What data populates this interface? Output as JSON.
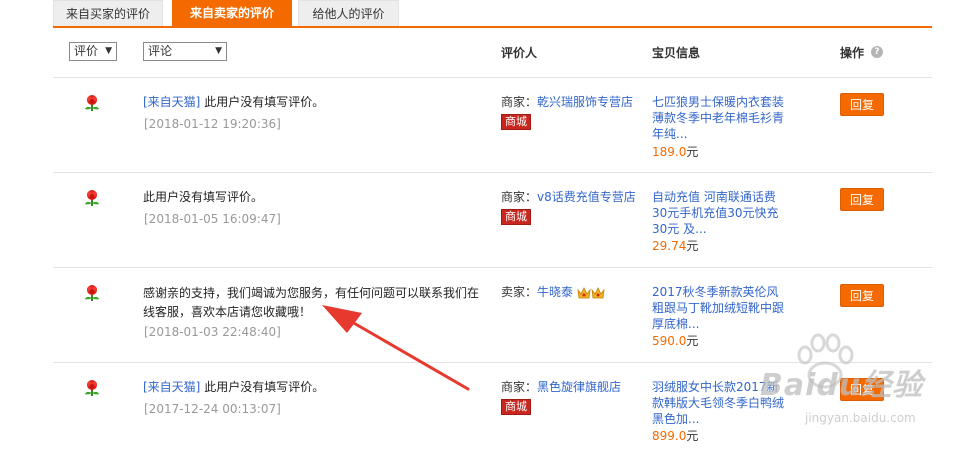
{
  "tabs": [
    {
      "label": "来自买家的评价"
    },
    {
      "label": "来自卖家的评价",
      "active": true
    },
    {
      "label": "给他人的评价"
    }
  ],
  "header": {
    "rating_filter": "评价",
    "comment_filter": "评论",
    "reviewer": "评价人",
    "item_info": "宝贝信息",
    "action": "操作",
    "help": "?"
  },
  "rows": [
    {
      "tag": "[来自天猫]",
      "comment": "此用户没有填写评价。",
      "time": "[2018-01-12 19:20:36]",
      "role": "商家：",
      "shop": "乾兴瑞服饰专营店",
      "badge": "商城",
      "item": "七匹狼男士保暖内衣套装薄款冬季中老年棉毛衫青年纯...",
      "price": "189.0",
      "unit": "元",
      "reply": "回复"
    },
    {
      "tag": "",
      "comment": "此用户没有填写评价。",
      "time": "[2018-01-05 16:09:47]",
      "role": "商家：",
      "shop": "v8话费充值专营店",
      "badge": "商城",
      "item": "自动充值 河南联通话费30元手机充值30元快充30元 及...",
      "price": "29.74",
      "unit": "元",
      "reply": "回复"
    },
    {
      "tag": "",
      "comment": "感谢亲的支持，我们竭诚为您服务，有任何问题可以联系我们在线客服，喜欢本店请您收藏哦！",
      "time": "[2018-01-03 22:48:40]",
      "role": "卖家：",
      "shop": "牛晓泰",
      "badge": "",
      "item": "2017秋冬季新款英伦风粗跟马丁靴加绒短靴中跟厚底棉...",
      "price": "590.0",
      "unit": "元",
      "reply": "回复"
    },
    {
      "tag": "[来自天猫]",
      "comment": "此用户没有填写评价。",
      "time": "[2017-12-24 00:13:07]",
      "role": "商家：",
      "shop": "黑色旋律旗舰店",
      "badge": "商城",
      "item": "羽绒服女中长款2017新款韩版大毛领冬季白鸭绒黑色加...",
      "price": "899.0",
      "unit": "元",
      "reply": "回复"
    }
  ],
  "watermark": {
    "brand": "Baidu经验",
    "url": "jingyan.baidu.com"
  },
  "colors": {
    "accent": "#f56a00",
    "link": "#3366cc",
    "badge": "#c8261e",
    "annotation_arrow": "#e8392f"
  }
}
